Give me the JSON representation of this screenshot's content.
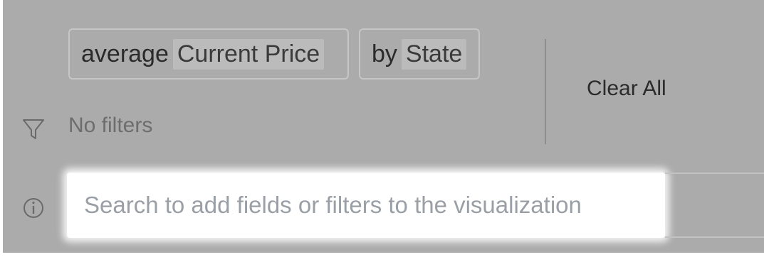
{
  "query_pills": [
    {
      "prefix": "average",
      "field": "Current Price"
    },
    {
      "prefix": "by",
      "field": "State"
    }
  ],
  "clear_all_label": "Clear All",
  "filters": {
    "icon": "filter-funnel-icon",
    "empty_text": "No filters"
  },
  "search": {
    "icon": "info-icon",
    "value": "",
    "placeholder": "Search to add fields or filters to the visualization"
  },
  "colors": {
    "overlay_gray": "#ababab",
    "field_highlight": "#bbbbbb",
    "search_bg": "#ffffff",
    "placeholder_text": "#9a9fa6"
  }
}
